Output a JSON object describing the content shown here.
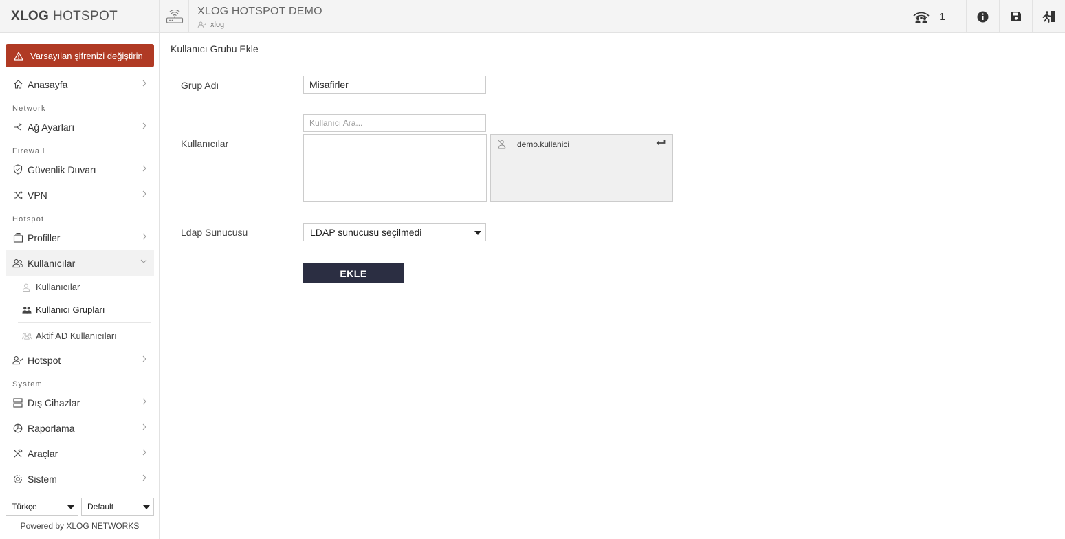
{
  "brand": {
    "bold": "XLOG",
    "rest": "HOTSPOT"
  },
  "alert": {
    "text": "Varsayılan şifrenizi değiştirin"
  },
  "sidebar": {
    "home": "Anasayfa",
    "sec_network": "Network",
    "network": "Ağ Ayarları",
    "sec_firewall": "Firewall",
    "firewall": "Güvenlik Duvarı",
    "vpn": "VPN",
    "sec_hotspot": "Hotspot",
    "profiles": "Profiller",
    "users": "Kullanıcılar",
    "sub_users": "Kullanıcılar",
    "sub_groups": "Kullanıcı Grupları",
    "sub_ad": "Aktif AD Kullanıcıları",
    "hotspot": "Hotspot",
    "sec_system": "System",
    "external": "Dış Cihazlar",
    "reports": "Raporlama",
    "tools": "Araçlar",
    "system": "Sistem"
  },
  "footer": {
    "language": "Türkçe",
    "theme": "Default",
    "powered": "Powered by XLOG NETWORKS"
  },
  "topbar": {
    "title": "XLOG HOTSPOT DEMO",
    "user": "xlog",
    "online_count": "1"
  },
  "form": {
    "page_title": "Kullanıcı Grubu Ekle",
    "group_name_label": "Grup Adı",
    "group_name_value": "Misafirler",
    "users_label": "Kullanıcılar",
    "search_placeholder": "Kullanıcı Ara...",
    "selected_users": [
      "demo.kullanici"
    ],
    "ldap_label": "Ldap Sunucusu",
    "ldap_value": "LDAP sunucusu seçilmedi",
    "submit": "EKLE"
  }
}
